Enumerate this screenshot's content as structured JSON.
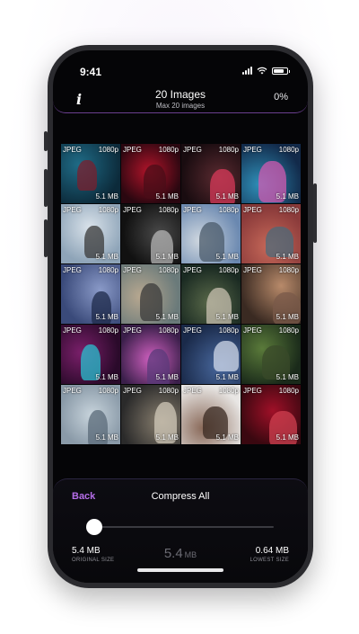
{
  "status_bar": {
    "time": "9:41"
  },
  "header": {
    "info_icon": "info-icon",
    "title": "20 Images",
    "subtitle": "Max 20 images",
    "percent": "0%"
  },
  "images": [
    {
      "format": "JPEG",
      "resolution": "1080p",
      "size": "5.1 MB",
      "colors": [
        "#0c2a3a",
        "#1f6b86",
        "#7a1f2e"
      ]
    },
    {
      "format": "JPEG",
      "resolution": "1080p",
      "size": "5.1 MB",
      "colors": [
        "#2a0710",
        "#b0142a",
        "#4a0d18"
      ]
    },
    {
      "format": "JPEG",
      "resolution": "1080p",
      "size": "5.1 MB",
      "colors": [
        "#190c10",
        "#5a2a30",
        "#d83a5a"
      ]
    },
    {
      "format": "JPEG",
      "resolution": "1080p",
      "size": "5.1 MB",
      "colors": [
        "#122a4a",
        "#2f8fb8",
        "#d15ab0"
      ]
    },
    {
      "format": "JPEG",
      "resolution": "1080p",
      "size": "5.1 MB",
      "colors": [
        "#8ea4b8",
        "#d9e2ea",
        "#3a3a3a"
      ]
    },
    {
      "format": "JPEG",
      "resolution": "1080p",
      "size": "5.1 MB",
      "colors": [
        "#111111",
        "#4a4a4a",
        "#b5b5b5"
      ]
    },
    {
      "format": "JPEG",
      "resolution": "1080p",
      "size": "5.1 MB",
      "colors": [
        "#6a88b0",
        "#d0d8e0",
        "#4a5a6a"
      ]
    },
    {
      "format": "JPEG",
      "resolution": "1080p",
      "size": "5.1 MB",
      "colors": [
        "#8a3a3a",
        "#c86a5a",
        "#4a6a7a"
      ]
    },
    {
      "format": "JPEG",
      "resolution": "1080p",
      "size": "5.1 MB",
      "colors": [
        "#3a4a7a",
        "#8a9ac8",
        "#1e2a4a"
      ]
    },
    {
      "format": "JPEG",
      "resolution": "1080p",
      "size": "5.1 MB",
      "colors": [
        "#6a7a7a",
        "#b8a890",
        "#3a3a3a"
      ]
    },
    {
      "format": "JPEG",
      "resolution": "1080p",
      "size": "5.1 MB",
      "colors": [
        "#1a2a22",
        "#5a6a4a",
        "#c8c0b0"
      ]
    },
    {
      "format": "JPEG",
      "resolution": "1080p",
      "size": "5.1 MB",
      "colors": [
        "#3a2a22",
        "#b88a6a",
        "#7a5a4a"
      ]
    },
    {
      "format": "JPEG",
      "resolution": "1080p",
      "size": "5.1 MB",
      "colors": [
        "#2a0a2a",
        "#7a1f6a",
        "#2ac0d0"
      ]
    },
    {
      "format": "JPEG",
      "resolution": "1080p",
      "size": "5.1 MB",
      "colors": [
        "#3a1f4a",
        "#d060c0",
        "#5a3a7a"
      ]
    },
    {
      "format": "JPEG",
      "resolution": "1080p",
      "size": "5.1 MB",
      "colors": [
        "#1a2a4a",
        "#4a6aa0",
        "#d0d8e8"
      ]
    },
    {
      "format": "JPEG",
      "resolution": "1080p",
      "size": "5.1 MB",
      "colors": [
        "#1a2a1a",
        "#5a7a3a",
        "#3a4a2a"
      ]
    },
    {
      "format": "JPEG",
      "resolution": "1080p",
      "size": "5.1 MB",
      "colors": [
        "#8a9aa8",
        "#c8d4dc",
        "#5a6a78"
      ]
    },
    {
      "format": "JPEG",
      "resolution": "1080p",
      "size": "5.1 MB",
      "colors": [
        "#2a2a2a",
        "#8a8070",
        "#d0c8b8"
      ]
    },
    {
      "format": "JPEG",
      "resolution": "1080p",
      "size": "5.1 MB",
      "colors": [
        "#e8e6e4",
        "#8a6a5a",
        "#3a2a22"
      ]
    },
    {
      "format": "JPEG",
      "resolution": "1080p",
      "size": "5.1 MB",
      "colors": [
        "#3a0810",
        "#a01028",
        "#d04050"
      ]
    }
  ],
  "bottom": {
    "back_label": "Back",
    "compress_label": "Compress All",
    "slider_fraction": 0,
    "original_size_value": "5.4 MB",
    "original_size_label": "ORIGINAL SIZE",
    "current_value": "5.4",
    "current_unit": "MB",
    "lowest_size_value": "0.64 MB",
    "lowest_size_label": "LOWEST SIZE"
  },
  "colors": {
    "accent": "#b56ee8",
    "header_border": "#6a3f8f",
    "background": "#050507"
  }
}
